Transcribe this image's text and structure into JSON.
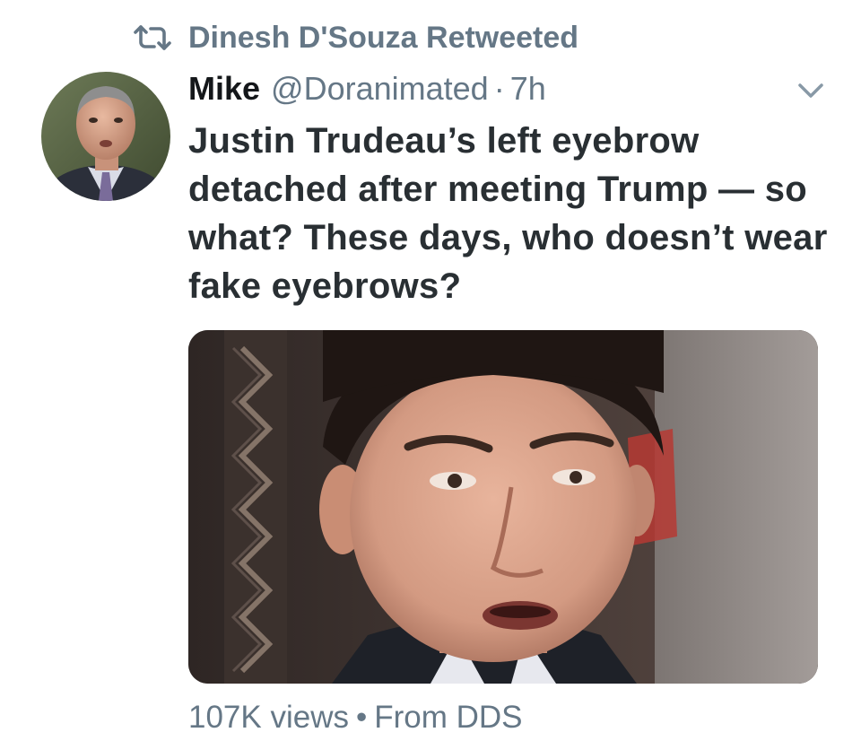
{
  "social_context": {
    "icon": "retweet-icon",
    "text": "Dinesh D'Souza Retweeted"
  },
  "tweet": {
    "display_name": "Mike",
    "handle": "@Doranimated",
    "separator": "·",
    "time": "7h",
    "menu_icon": "chevron-down-icon",
    "text": "Justin Trudeau’s left eyebrow detached after meeting Trump — so what? These days, who doesn’t wear fake eyebrows?",
    "media": {
      "type": "video-thumbnail"
    },
    "views": "107K views",
    "bullet": "•",
    "source": "From DDS"
  },
  "colors": {
    "secondary_text": "#657786",
    "primary_text": "#14171a"
  }
}
